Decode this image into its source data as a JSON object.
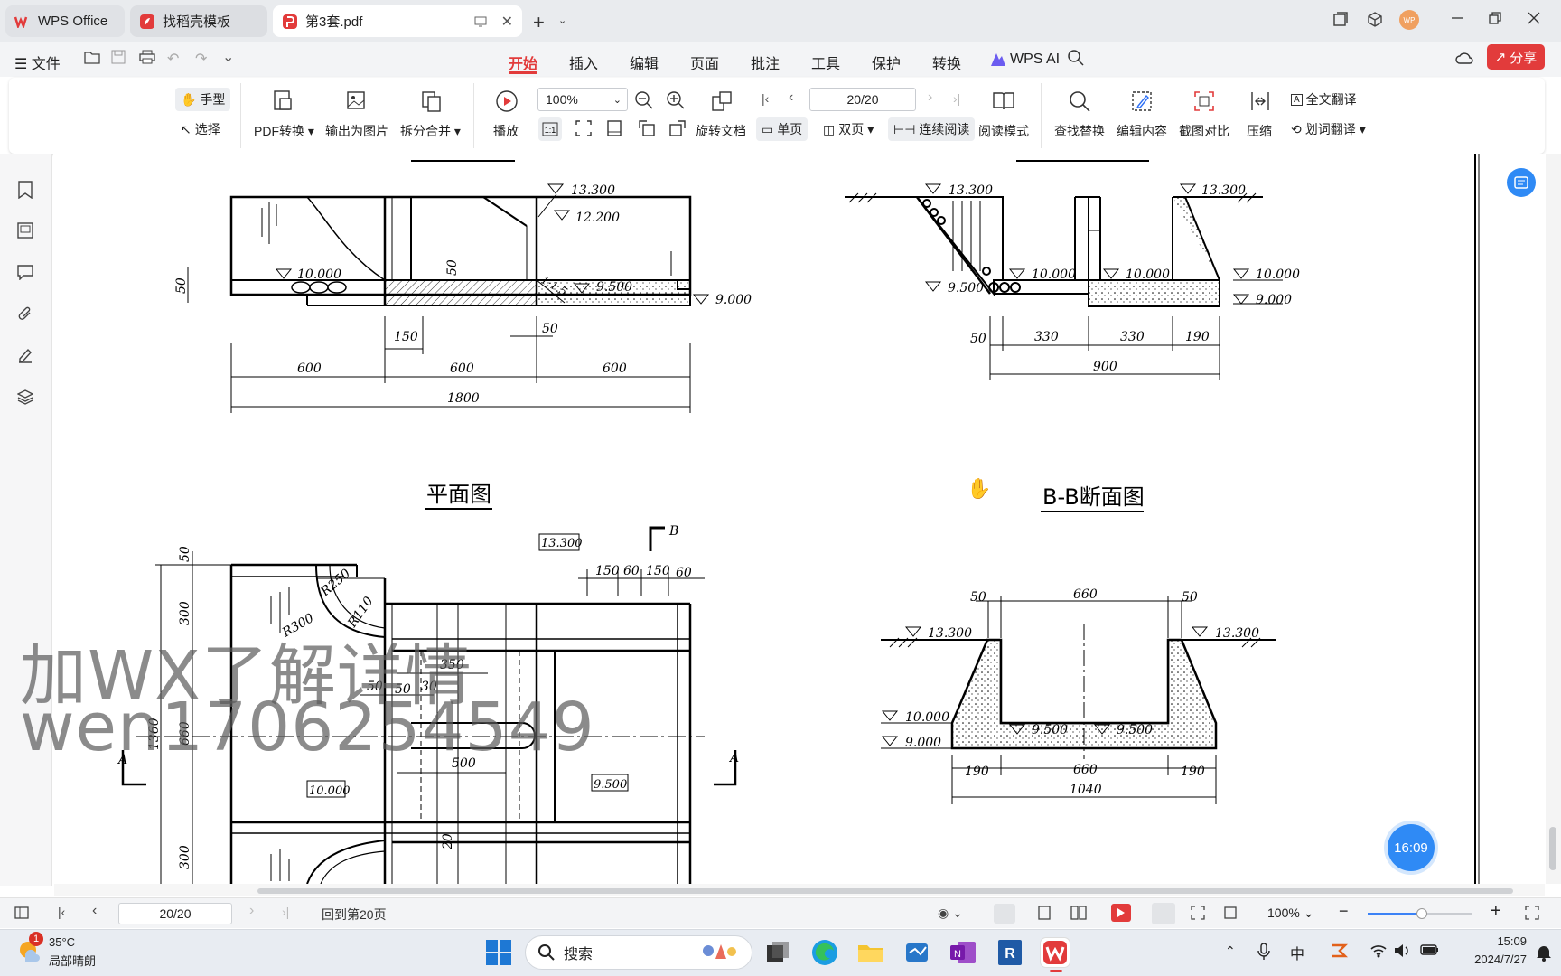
{
  "titlebar": {
    "tabs": [
      {
        "label": "WPS Office"
      },
      {
        "label": "找稻壳模板"
      },
      {
        "label": "第3套.pdf"
      }
    ]
  },
  "menubar": {
    "file": "文件",
    "items": [
      "开始",
      "插入",
      "编辑",
      "页面",
      "批注",
      "工具",
      "保护",
      "转换",
      "WPS AI"
    ],
    "share": "分享"
  },
  "ribbon": {
    "hand": "手型",
    "select": "选择",
    "pdf_convert": "PDF转换",
    "export_image": "输出为图片",
    "split_merge": "拆分合并",
    "play": "播放",
    "zoom": "100%",
    "page_input": "20/20",
    "rotate": "旋转文档",
    "single": "单页",
    "double": "双页",
    "continuous": "连续阅读",
    "reading_mode": "阅读模式",
    "find_replace": "查找替换",
    "edit_content": "编辑内容",
    "screenshot_compare": "截图对比",
    "compress": "压缩",
    "full_translate": "全文翻译",
    "word_translate": "划词翻译"
  },
  "drawing": {
    "titles": {
      "plan": "平面图",
      "bb": "B-B断面图"
    },
    "elev_top_left": [
      "13.300",
      "12.200",
      "10.000",
      "9.500",
      "9.000"
    ],
    "dims_top_left": [
      "150",
      "50",
      "600",
      "600",
      "600",
      "1800",
      "50",
      "50",
      "1:1.5"
    ],
    "elev_top_right": [
      "13.300",
      "13.300",
      "10.000",
      "10.000",
      "10.000",
      "9.500",
      "9.000"
    ],
    "dims_top_right": [
      "50",
      "330",
      "330",
      "190",
      "900"
    ],
    "plan_labels": [
      "13.300",
      "B",
      "150",
      "60",
      "150",
      "60",
      "R250",
      "R300",
      "R110",
      "350",
      "50",
      "50",
      "30",
      "500",
      "10.000",
      "9.500",
      "A",
      "A",
      "50",
      "300",
      "660",
      "1360",
      "300",
      "20"
    ],
    "bb_elev": [
      "13.300",
      "13.300",
      "10.000",
      "9.000",
      "9.500",
      "9.500"
    ],
    "bb_dims": [
      "50",
      "660",
      "50",
      "190",
      "660",
      "190",
      "1040"
    ]
  },
  "watermark": {
    "line1": "加WX了解详情",
    "line2": "wen1706254549"
  },
  "floating_clock": "16:09",
  "statusbar": {
    "page_input": "20/20",
    "back_to": "回到第20页",
    "zoom": "100%"
  },
  "taskbar": {
    "weather_temp": "35°C",
    "weather_desc": "局部晴朗",
    "weather_badge": "1",
    "search": "搜索",
    "time": "15:09",
    "date": "2024/7/27",
    "ime": "中"
  }
}
